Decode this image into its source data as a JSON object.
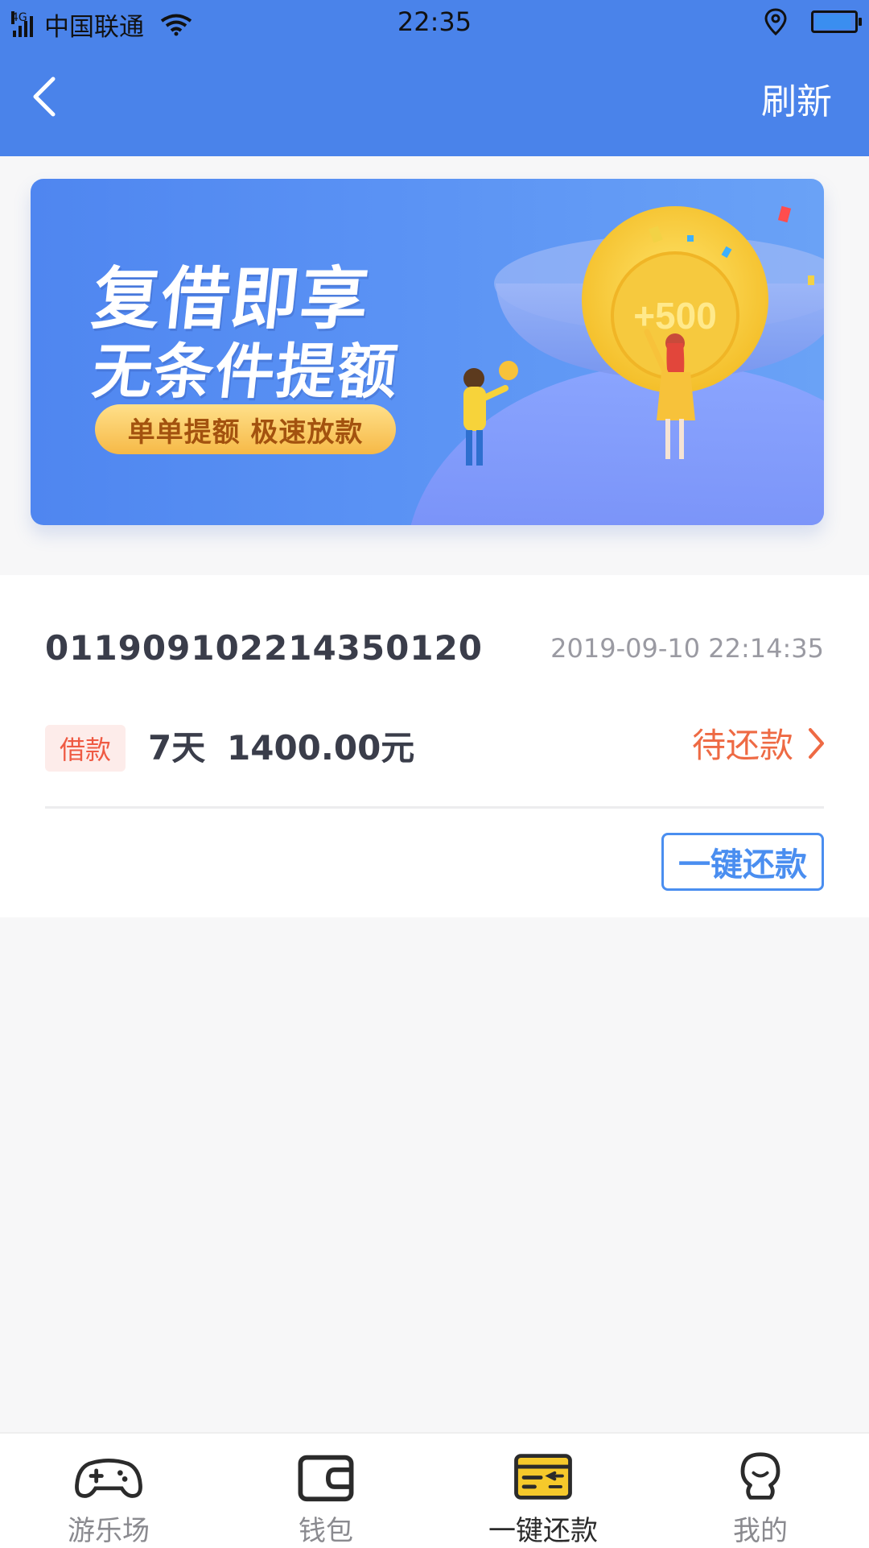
{
  "status_bar": {
    "network": "4G",
    "carrier": "中国联通",
    "time": "22:35"
  },
  "header": {
    "refresh_label": "刷新"
  },
  "banner": {
    "title_line1": "复借即享",
    "title_line2": "无条件提额",
    "pill_text": "单单提额 极速放款",
    "coin_text": "+500"
  },
  "order": {
    "order_no": "0119091022143501​20",
    "datetime": "2019-09-10 22:14:35",
    "type_tag": "借款",
    "term": "7天",
    "amount": "1400.00元",
    "status": "待还款",
    "repay_button": "一键还款"
  },
  "tabbar": {
    "items": [
      {
        "label": "游乐场",
        "icon": "gamepad-icon",
        "active": false
      },
      {
        "label": "钱包",
        "icon": "wallet-icon",
        "active": false
      },
      {
        "label": "一键还款",
        "icon": "repay-card-icon",
        "active": true
      },
      {
        "label": "我的",
        "icon": "profile-icon",
        "active": false
      }
    ]
  },
  "colors": {
    "primary": "#4a83ea",
    "status_orange": "#ee6a44",
    "tag_bg": "#fdecea",
    "button_blue": "#4a8ef0"
  }
}
